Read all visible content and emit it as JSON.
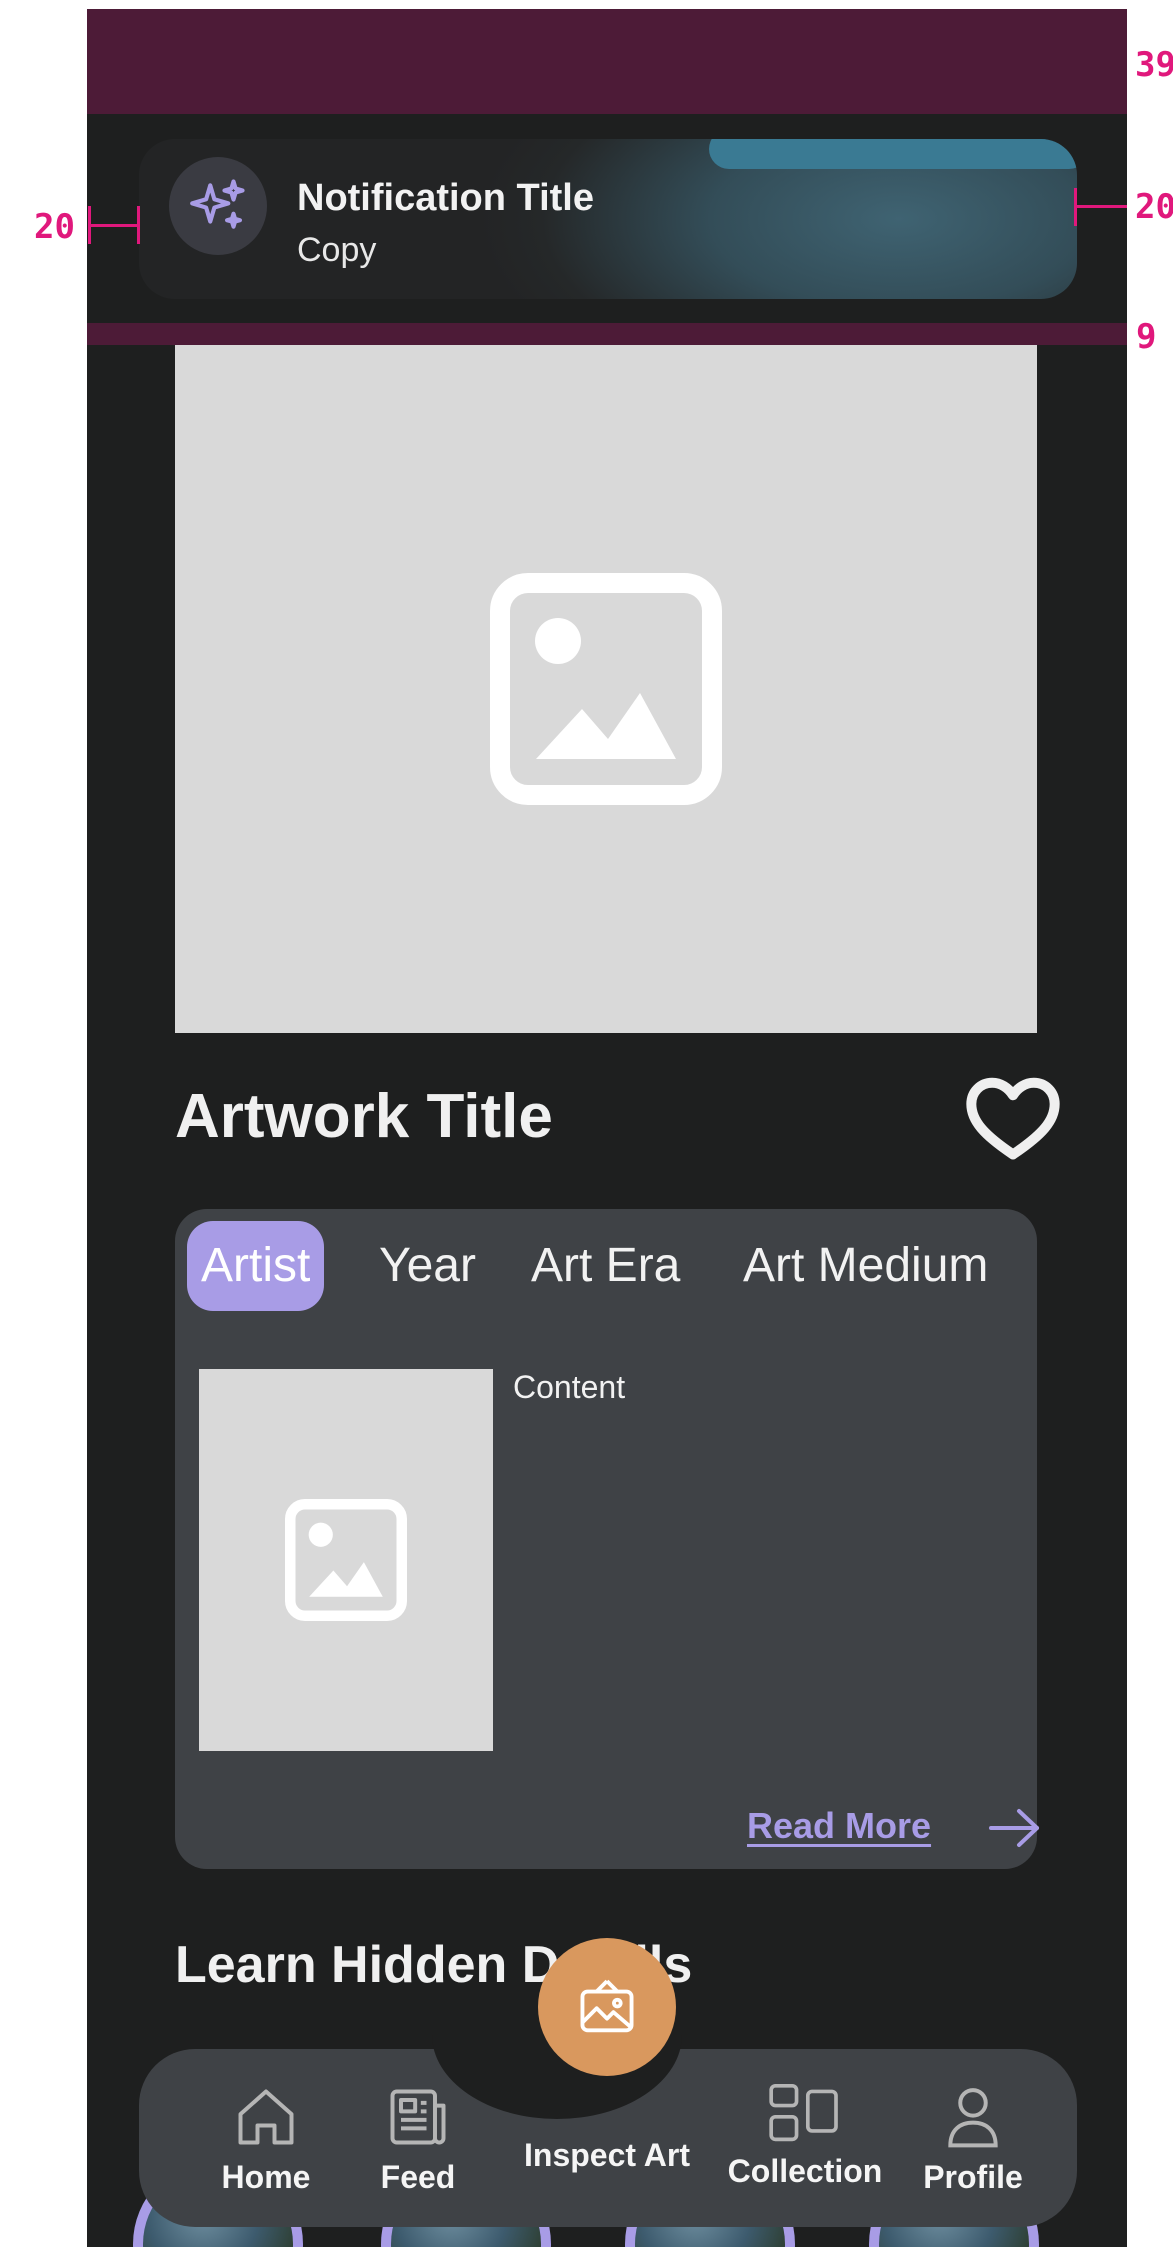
{
  "spec": {
    "top_inset": "39",
    "left_margin": "20",
    "right_margin": "20",
    "gap_below": "9"
  },
  "notification": {
    "title": "Notification Title",
    "copy": "Copy",
    "icon": "sparkles-icon"
  },
  "artwork": {
    "title": "Artwork Title",
    "favorite_icon": "heart-icon"
  },
  "info_card": {
    "tabs": [
      {
        "label": "Artist",
        "active": true
      },
      {
        "label": "Year",
        "active": false
      },
      {
        "label": "Art Era",
        "active": false
      },
      {
        "label": "Art Medium",
        "active": false
      }
    ],
    "content": "Content",
    "read_more": "Read More"
  },
  "section": {
    "title": "Learn Hidden Details"
  },
  "nav": {
    "items": [
      {
        "label": "Home",
        "icon": "home-icon"
      },
      {
        "label": "Feed",
        "icon": "newspaper-icon"
      },
      {
        "label": "Inspect Art",
        "icon": "photo-icon"
      },
      {
        "label": "Collection",
        "icon": "grid-icon"
      },
      {
        "label": "Profile",
        "icon": "user-icon"
      }
    ]
  },
  "colors": {
    "accent": "#a89ce6",
    "fab": "#d9985e",
    "background": "#1e1f1f",
    "card": "#3f4246",
    "spec_band": "#4d1b37",
    "spec_annotation": "#e0187c"
  }
}
